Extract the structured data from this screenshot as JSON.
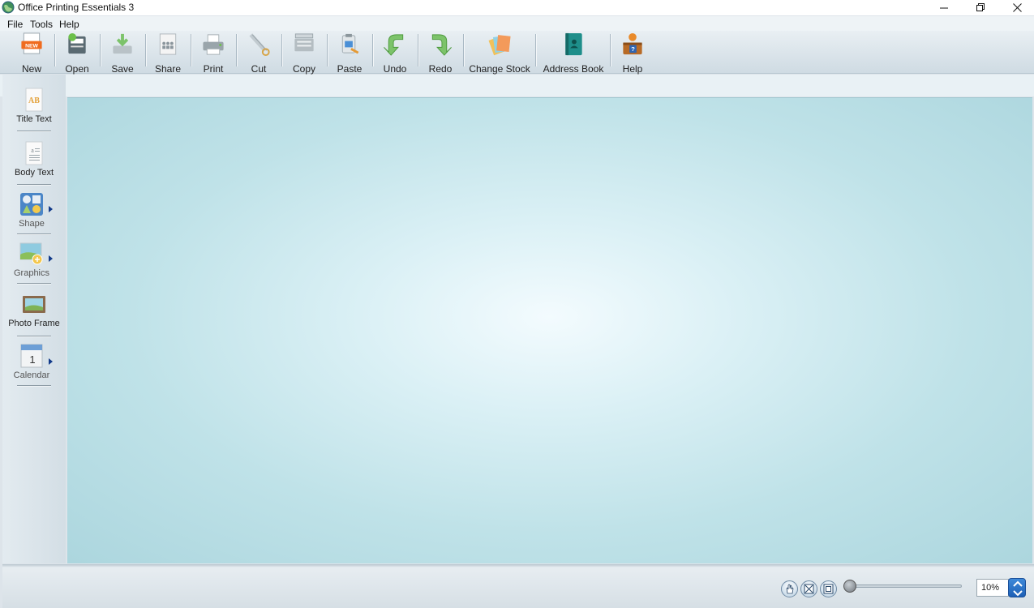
{
  "window": {
    "title": "Office Printing Essentials 3",
    "app_icon": "globe-icon",
    "controls": [
      "minimize-icon",
      "restore-icon",
      "close-icon"
    ]
  },
  "menu": {
    "items": [
      "File",
      "Tools",
      "Help"
    ]
  },
  "toolbar": {
    "buttons": [
      {
        "label": "New",
        "icon": "new-document-icon"
      },
      {
        "label": "Open",
        "icon": "open-folder-icon"
      },
      {
        "label": "Save",
        "icon": "save-icon"
      },
      {
        "label": "Share",
        "icon": "share-icon"
      },
      {
        "label": "Print",
        "icon": "printer-icon"
      },
      {
        "label": "Cut",
        "icon": "scissors-icon"
      },
      {
        "label": "Copy",
        "icon": "copier-icon"
      },
      {
        "label": "Paste",
        "icon": "paste-icon"
      },
      {
        "label": "Undo",
        "icon": "undo-icon"
      },
      {
        "label": "Redo",
        "icon": "redo-icon"
      },
      {
        "label": "Change Stock",
        "icon": "paper-stock-icon"
      },
      {
        "label": "Address Book",
        "icon": "address-book-icon"
      },
      {
        "label": "Help",
        "icon": "help-icon"
      }
    ]
  },
  "palette": {
    "items": [
      {
        "label": "Title Text",
        "icon": "title-text-icon",
        "has_submenu": false
      },
      {
        "label": "Body Text",
        "icon": "body-text-icon",
        "has_submenu": false
      },
      {
        "label": "Shape",
        "icon": "shape-icon",
        "has_submenu": true
      },
      {
        "label": "Graphics",
        "icon": "graphics-icon",
        "has_submenu": true
      },
      {
        "label": "Photo Frame",
        "icon": "photo-frame-icon",
        "has_submenu": false
      },
      {
        "label": "Calendar",
        "icon": "calendar-icon",
        "has_submenu": true
      }
    ]
  },
  "statusbar": {
    "tools": [
      "pan-hand-icon",
      "fit-page-icon",
      "actual-size-icon"
    ],
    "zoom_value": "10%",
    "zoom_fraction": 0.0
  },
  "colors": {
    "canvas_center": "#f3fbfe",
    "canvas_edge": "#acd6de",
    "toolbar_top": "#e9eff3",
    "toolbar_bottom": "#cfdbe3",
    "spinner": "#2a72c9"
  }
}
